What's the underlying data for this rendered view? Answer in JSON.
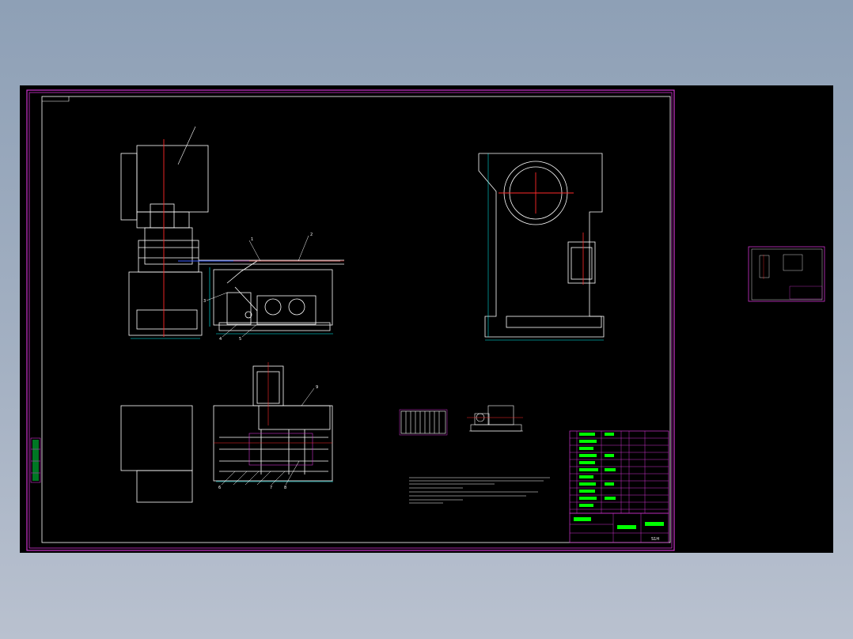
{
  "app": {
    "name": "CAD drawing viewer",
    "background_color": "#000000",
    "frame_color": "#cc33cc",
    "geometry_color": "#ffffff",
    "centerline_color": "#ff2a2a",
    "annotation_color": "#00ff00",
    "dimension_color": "#00ffff"
  },
  "drawing": {
    "title_block_text": "S1H",
    "view_labels": [
      "1",
      "2",
      "3",
      "4",
      "5",
      "6",
      "7",
      "8",
      "9"
    ]
  }
}
